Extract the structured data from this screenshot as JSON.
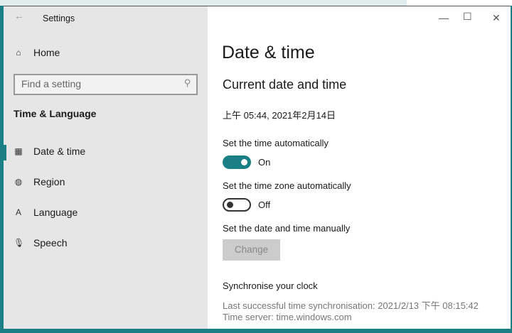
{
  "window": {
    "title": "Settings",
    "back": "←",
    "minimize": "—",
    "maximize": "☐",
    "close": "✕"
  },
  "sidebar": {
    "home": "Home",
    "search_placeholder": "Find a setting",
    "section": "Time & Language",
    "items": [
      {
        "label": "Date & time",
        "icon": "calendar-clock-icon"
      },
      {
        "label": "Region",
        "icon": "globe-icon"
      },
      {
        "label": "Language",
        "icon": "language-icon"
      },
      {
        "label": "Speech",
        "icon": "microphone-icon"
      }
    ]
  },
  "main": {
    "title": "Date & time",
    "subtitle": "Current date and time",
    "current": "上午 05:44, 2021年2月14日",
    "auto_time_label": "Set the time automatically",
    "auto_time_state": "On",
    "auto_tz_label": "Set the time zone automatically",
    "auto_tz_state": "Off",
    "manual_label": "Set the date and time manually",
    "change": "Change",
    "sync_title": "Synchronise your clock",
    "last_sync": "Last successful time synchronisation: 2021/2/13 下午 08:15:42",
    "server": "Time server: time.windows.com"
  },
  "colors": {
    "accent": "#1b7f86"
  }
}
